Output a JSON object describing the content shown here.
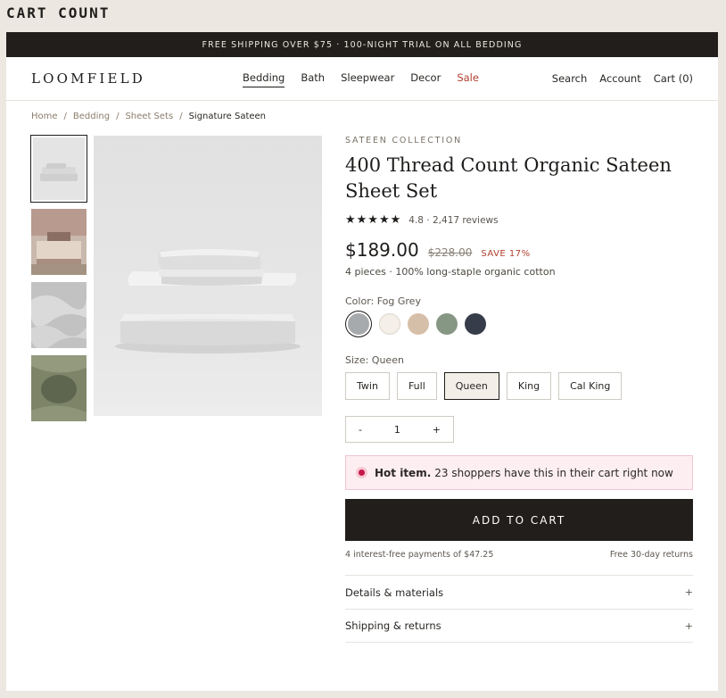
{
  "caption": "CART COUNT",
  "promo": "FREE SHIPPING OVER $75 · 100-NIGHT TRIAL ON ALL BEDDING",
  "brand": "LOOMFIELD",
  "nav": [
    "Bedding",
    "Bath",
    "Sleepwear",
    "Decor",
    "Sale"
  ],
  "util": {
    "search": "Search",
    "account": "Account",
    "cart": "Cart (0)"
  },
  "breadcrumb": [
    "Home",
    "/",
    "Bedding",
    "/",
    "Sheet Sets",
    "/",
    "Signature Sateen"
  ],
  "product": {
    "eyebrow": "SATEEN COLLECTION",
    "title": "400 Thread Count Organic Sateen Sheet Set",
    "stars": "★★★★★",
    "rating": "4.8 · 2,417 reviews",
    "price": "$189.00",
    "was": "$228.00",
    "save": "SAVE 17%",
    "pieces": "4 pieces · 100% long-staple organic cotton",
    "color_label": "Color:",
    "color_value": "Fog Grey",
    "swatches": [
      "#a7aaad",
      "#f4efe8",
      "#d6bfa9",
      "#869784",
      "#363c4a"
    ],
    "size_label": "Size:",
    "size_value": "Queen",
    "sizes": [
      "Twin",
      "Full",
      "Queen",
      "King",
      "Cal King"
    ],
    "qty": {
      "minus": "-",
      "value": "1",
      "plus": "+"
    },
    "hot_bold": "Hot item.",
    "hot_text": "23 shoppers have this in their cart right now",
    "cta": "ADD TO CART",
    "installments": "4 interest-free payments of $47.25",
    "returns": "Free 30-day returns",
    "accordions": [
      "Details & materials",
      "Shipping & returns"
    ],
    "accordion_icon": "+"
  },
  "colors": {
    "accent": "#211e1b",
    "sale": "#b0402e",
    "hot_bg": "#fdeef1",
    "hot_dot": "#c4184a"
  }
}
